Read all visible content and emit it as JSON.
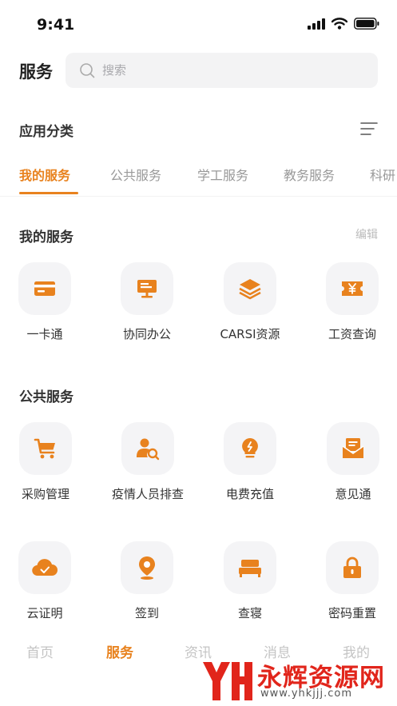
{
  "status": {
    "time": "9:41"
  },
  "header": {
    "title": "服务",
    "search_placeholder": "搜索"
  },
  "category": {
    "title": "应用分类"
  },
  "tabs": [
    {
      "label": "我的服务",
      "active": true
    },
    {
      "label": "公共服务",
      "active": false
    },
    {
      "label": "学工服务",
      "active": false
    },
    {
      "label": "教务服务",
      "active": false
    },
    {
      "label": "科研",
      "active": false
    }
  ],
  "my_services": {
    "title": "我的服务",
    "edit_label": "编辑",
    "apps": [
      {
        "label": "一卡通",
        "icon": "card-icon"
      },
      {
        "label": "协同办公",
        "icon": "monitor-icon"
      },
      {
        "label": "CARSI资源",
        "icon": "layers-icon"
      },
      {
        "label": "工资查询",
        "icon": "yen-ticket-icon"
      }
    ]
  },
  "public_services": {
    "title": "公共服务",
    "apps": [
      {
        "label": "采购管理",
        "icon": "cart-icon"
      },
      {
        "label": "疫情人员排查",
        "icon": "person-search-icon"
      },
      {
        "label": "电费充值",
        "icon": "bulb-icon"
      },
      {
        "label": "意见通",
        "icon": "mail-icon"
      },
      {
        "label": "云证明",
        "icon": "cloud-check-icon"
      },
      {
        "label": "签到",
        "icon": "location-pin-icon"
      },
      {
        "label": "查寝",
        "icon": "bed-icon"
      },
      {
        "label": "密码重置",
        "icon": "lock-icon"
      }
    ]
  },
  "bottom_nav": [
    {
      "label": "首页",
      "active": false
    },
    {
      "label": "服务",
      "active": true
    },
    {
      "label": "资讯",
      "active": false
    },
    {
      "label": "消息",
      "active": false
    },
    {
      "label": "我的",
      "active": false
    }
  ],
  "watermark": {
    "text": "永辉资源网",
    "url": "www.yhkjjj.com"
  },
  "colors": {
    "accent": "#e8821e",
    "icon_bg": "#f4f4f6",
    "watermark": "#e1251b"
  }
}
